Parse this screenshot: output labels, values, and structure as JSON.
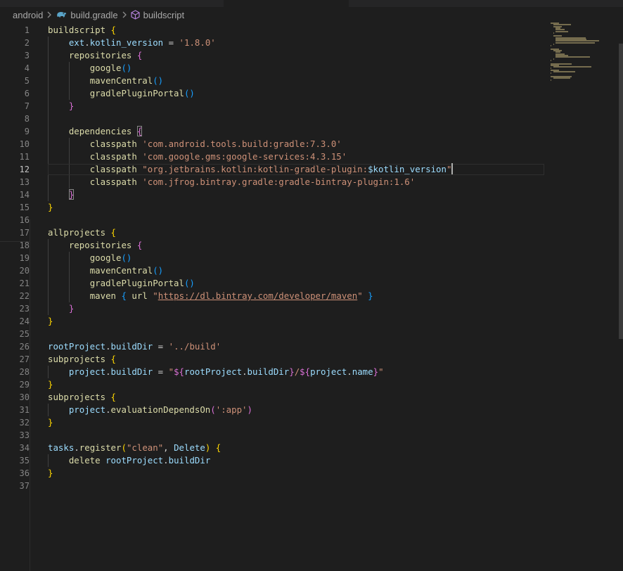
{
  "breadcrumb": {
    "items": [
      {
        "label": "android",
        "icon": "none"
      },
      {
        "label": "build.gradle",
        "icon": "gradle-elephant-icon"
      },
      {
        "label": "buildscript",
        "icon": "cube-symbol-icon"
      }
    ]
  },
  "editor": {
    "current_line": 12,
    "colors": {
      "background": "#1e1e1e",
      "plain": "#d4d4d4",
      "function": "#dcdcaa",
      "variable": "#9cdcfe",
      "string": "#ce9178",
      "bracket_level_1": "#ffd700",
      "bracket_level_2": "#da70d6",
      "bracket_level_3": "#179fff",
      "line_number": "#858585"
    },
    "lines": [
      {
        "n": "1",
        "tokens": [
          [
            "fn",
            "buildscript"
          ],
          [
            "plain",
            " "
          ],
          [
            "b1",
            "{"
          ]
        ]
      },
      {
        "n": "2",
        "tokens": [
          [
            "plain",
            "    "
          ],
          [
            "var",
            "ext"
          ],
          [
            "plain",
            "."
          ],
          [
            "var",
            "kotlin_version"
          ],
          [
            "plain",
            " = "
          ],
          [
            "str",
            "'1.8.0'"
          ]
        ]
      },
      {
        "n": "3",
        "tokens": [
          [
            "plain",
            "    "
          ],
          [
            "fn",
            "repositories"
          ],
          [
            "plain",
            " "
          ],
          [
            "b2",
            "{"
          ]
        ]
      },
      {
        "n": "4",
        "tokens": [
          [
            "plain",
            "        "
          ],
          [
            "fn",
            "google"
          ],
          [
            "b3",
            "()"
          ]
        ]
      },
      {
        "n": "5",
        "tokens": [
          [
            "plain",
            "        "
          ],
          [
            "fn",
            "mavenCentral"
          ],
          [
            "b3",
            "()"
          ]
        ]
      },
      {
        "n": "6",
        "tokens": [
          [
            "plain",
            "        "
          ],
          [
            "fn",
            "gradlePluginPortal"
          ],
          [
            "b3",
            "()"
          ]
        ]
      },
      {
        "n": "7",
        "tokens": [
          [
            "plain",
            "    "
          ],
          [
            "b2",
            "}"
          ]
        ]
      },
      {
        "n": "8",
        "tokens": []
      },
      {
        "n": "9",
        "tokens": [
          [
            "plain",
            "    "
          ],
          [
            "fn",
            "dependencies"
          ],
          [
            "plain",
            " "
          ],
          [
            "b2m",
            "{"
          ]
        ]
      },
      {
        "n": "10",
        "tokens": [
          [
            "plain",
            "        "
          ],
          [
            "fn",
            "classpath"
          ],
          [
            "plain",
            " "
          ],
          [
            "str",
            "'com.android.tools.build:gradle:7.3.0'"
          ]
        ]
      },
      {
        "n": "11",
        "tokens": [
          [
            "plain",
            "        "
          ],
          [
            "fn",
            "classpath"
          ],
          [
            "plain",
            " "
          ],
          [
            "str",
            "'com.google.gms:google-services:4.3.15'"
          ]
        ]
      },
      {
        "n": "12",
        "tokens": [
          [
            "plain",
            "        "
          ],
          [
            "fn",
            "classpath"
          ],
          [
            "plain",
            " "
          ],
          [
            "str",
            "\"org.jetbrains.kotlin:kotlin-gradle-plugin:"
          ],
          [
            "var",
            "$kotlin_version"
          ],
          [
            "str",
            "\""
          ],
          [
            "cursor",
            ""
          ]
        ]
      },
      {
        "n": "13",
        "tokens": [
          [
            "plain",
            "        "
          ],
          [
            "fn",
            "classpath"
          ],
          [
            "plain",
            " "
          ],
          [
            "str",
            "'com.jfrog.bintray.gradle:gradle-bintray-plugin:1.6'"
          ]
        ]
      },
      {
        "n": "14",
        "tokens": [
          [
            "plain",
            "    "
          ],
          [
            "b2m",
            "}"
          ]
        ]
      },
      {
        "n": "15",
        "tokens": [
          [
            "b1",
            "}"
          ]
        ]
      },
      {
        "n": "16",
        "tokens": []
      },
      {
        "n": "17",
        "tokens": [
          [
            "fn",
            "allprojects"
          ],
          [
            "plain",
            " "
          ],
          [
            "b1",
            "{"
          ]
        ]
      },
      {
        "n": "18",
        "tokens": [
          [
            "plain",
            "    "
          ],
          [
            "fn",
            "repositories"
          ],
          [
            "plain",
            " "
          ],
          [
            "b2",
            "{"
          ]
        ]
      },
      {
        "n": "19",
        "tokens": [
          [
            "plain",
            "        "
          ],
          [
            "fn",
            "google"
          ],
          [
            "b3",
            "()"
          ]
        ]
      },
      {
        "n": "20",
        "tokens": [
          [
            "plain",
            "        "
          ],
          [
            "fn",
            "mavenCentral"
          ],
          [
            "b3",
            "()"
          ]
        ]
      },
      {
        "n": "21",
        "tokens": [
          [
            "plain",
            "        "
          ],
          [
            "fn",
            "gradlePluginPortal"
          ],
          [
            "b3",
            "()"
          ]
        ]
      },
      {
        "n": "22",
        "tokens": [
          [
            "plain",
            "        "
          ],
          [
            "fn",
            "maven"
          ],
          [
            "plain",
            " "
          ],
          [
            "b3",
            "{"
          ],
          [
            "plain",
            " "
          ],
          [
            "fn",
            "url"
          ],
          [
            "plain",
            " "
          ],
          [
            "str",
            "\""
          ],
          [
            "url",
            "https://dl.bintray.com/developer/maven"
          ],
          [
            "str",
            "\""
          ],
          [
            "plain",
            " "
          ],
          [
            "b3",
            "}"
          ]
        ]
      },
      {
        "n": "23",
        "tokens": [
          [
            "plain",
            "    "
          ],
          [
            "b2",
            "}"
          ]
        ]
      },
      {
        "n": "24",
        "tokens": [
          [
            "b1",
            "}"
          ]
        ]
      },
      {
        "n": "25",
        "tokens": []
      },
      {
        "n": "26",
        "tokens": [
          [
            "var",
            "rootProject"
          ],
          [
            "plain",
            "."
          ],
          [
            "var",
            "buildDir"
          ],
          [
            "plain",
            " = "
          ],
          [
            "str",
            "'../build'"
          ]
        ]
      },
      {
        "n": "27",
        "tokens": [
          [
            "fn",
            "subprojects"
          ],
          [
            "plain",
            " "
          ],
          [
            "b1",
            "{"
          ]
        ]
      },
      {
        "n": "28",
        "tokens": [
          [
            "plain",
            "    "
          ],
          [
            "var",
            "project"
          ],
          [
            "plain",
            "."
          ],
          [
            "var",
            "buildDir"
          ],
          [
            "plain",
            " = "
          ],
          [
            "str",
            "\""
          ],
          [
            "b2",
            "${"
          ],
          [
            "var",
            "rootProject"
          ],
          [
            "plain",
            "."
          ],
          [
            "var",
            "buildDir"
          ],
          [
            "b2",
            "}"
          ],
          [
            "str",
            "/"
          ],
          [
            "b2",
            "${"
          ],
          [
            "var",
            "project"
          ],
          [
            "plain",
            "."
          ],
          [
            "var",
            "name"
          ],
          [
            "b2",
            "}"
          ],
          [
            "str",
            "\""
          ]
        ]
      },
      {
        "n": "29",
        "tokens": [
          [
            "b1",
            "}"
          ]
        ]
      },
      {
        "n": "30",
        "tokens": [
          [
            "fn",
            "subprojects"
          ],
          [
            "plain",
            " "
          ],
          [
            "b1",
            "{"
          ]
        ]
      },
      {
        "n": "31",
        "tokens": [
          [
            "plain",
            "    "
          ],
          [
            "var",
            "project"
          ],
          [
            "plain",
            "."
          ],
          [
            "fn",
            "evaluationDependsOn"
          ],
          [
            "b2",
            "("
          ],
          [
            "str",
            "':app'"
          ],
          [
            "b2",
            ")"
          ]
        ]
      },
      {
        "n": "32",
        "tokens": [
          [
            "b1",
            "}"
          ]
        ]
      },
      {
        "n": "33",
        "tokens": []
      },
      {
        "n": "34",
        "tokens": [
          [
            "var",
            "tasks"
          ],
          [
            "plain",
            "."
          ],
          [
            "fn",
            "register"
          ],
          [
            "b1",
            "("
          ],
          [
            "str",
            "\"clean\""
          ],
          [
            "plain",
            ", "
          ],
          [
            "var",
            "Delete"
          ],
          [
            "b1",
            ")"
          ],
          [
            "plain",
            " "
          ],
          [
            "b1",
            "{"
          ]
        ]
      },
      {
        "n": "35",
        "tokens": [
          [
            "plain",
            "    "
          ],
          [
            "fn",
            "delete"
          ],
          [
            "plain",
            " "
          ],
          [
            "var",
            "rootProject"
          ],
          [
            "plain",
            "."
          ],
          [
            "var",
            "buildDir"
          ]
        ]
      },
      {
        "n": "36",
        "tokens": [
          [
            "b1",
            "}"
          ]
        ]
      },
      {
        "n": "37",
        "tokens": []
      }
    ]
  }
}
